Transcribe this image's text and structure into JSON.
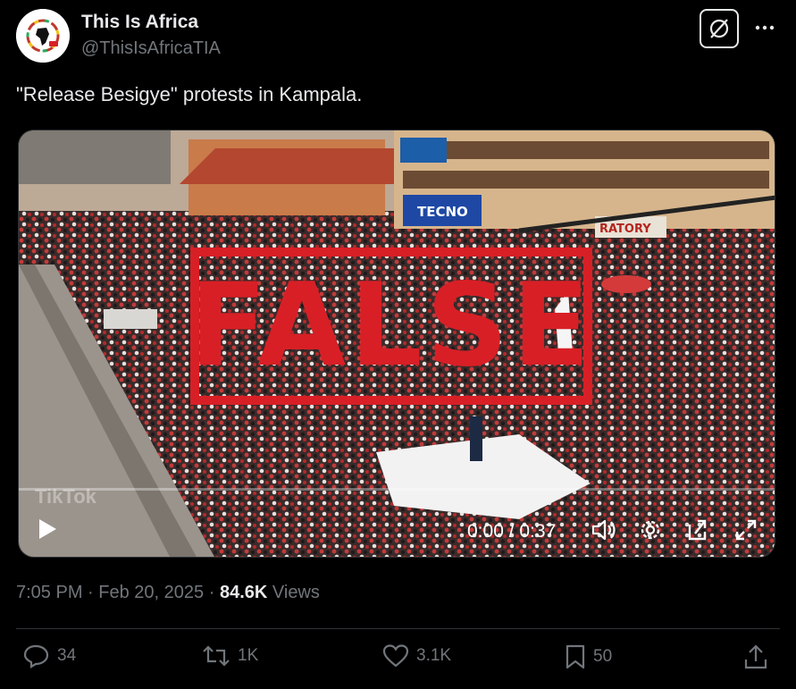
{
  "author": {
    "name": "This Is Africa",
    "handle": "@ThisIsAfricaTIA"
  },
  "post": {
    "text": "\"Release Besigye\" protests in Kampala."
  },
  "media": {
    "stamp_text": "FALSE",
    "watermark": "TikTok",
    "sign_text": "TECNO",
    "sign_text_2": "RATORY",
    "time_display": "0:00 / 0:37",
    "progress": 0
  },
  "meta": {
    "time": "7:05 PM",
    "date": "Feb 20, 2025",
    "views_count": "84.6K",
    "views_label": "Views",
    "separator": "·"
  },
  "actions": {
    "replies": "34",
    "reposts": "1K",
    "likes": "3.1K",
    "bookmarks": "50"
  },
  "colors": {
    "background": "#000000",
    "text_primary": "#e7e9ea",
    "text_secondary": "#71767b",
    "stamp_red": "#d81f26"
  },
  "icons": [
    "grok-icon",
    "more-icon",
    "play-icon",
    "volume-icon",
    "settings-icon",
    "popout-icon",
    "fullscreen-icon",
    "reply-icon",
    "repost-icon",
    "like-icon",
    "bookmark-icon",
    "share-icon"
  ]
}
